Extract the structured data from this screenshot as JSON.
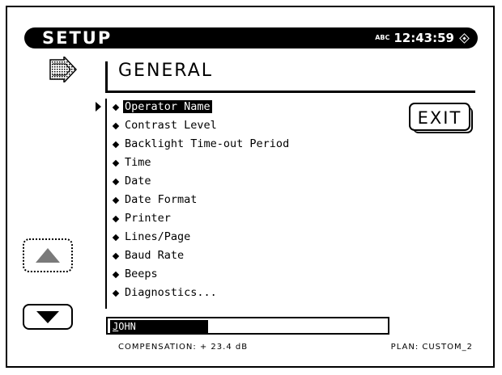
{
  "header": {
    "title": "SETUP",
    "status_small": "ABC",
    "time": "12:43:59",
    "status_icon": "diamond-icon"
  },
  "section": {
    "icon": "section-arrow-icon",
    "heading": "GENERAL"
  },
  "menu": {
    "items": [
      {
        "label": "Operator Name",
        "selected": true
      },
      {
        "label": "Contrast Level",
        "selected": false
      },
      {
        "label": "Backlight Time-out Period",
        "selected": false
      },
      {
        "label": "Time",
        "selected": false
      },
      {
        "label": "Date",
        "selected": false
      },
      {
        "label": "Date Format",
        "selected": false
      },
      {
        "label": "Printer",
        "selected": false
      },
      {
        "label": "Lines/Page",
        "selected": false
      },
      {
        "label": "Baud Rate",
        "selected": false
      },
      {
        "label": "Beeps",
        "selected": false
      },
      {
        "label": "Diagnostics...",
        "selected": false
      }
    ]
  },
  "buttons": {
    "exit_label": "EXIT",
    "scroll_up_icon": "triangle-up-icon",
    "scroll_down_icon": "triangle-down-icon"
  },
  "field": {
    "value_first": "J",
    "value_rest": "OHN"
  },
  "footer": {
    "compensation": "COMPENSATION: + 23.4 dB",
    "plan": "PLAN: CUSTOM_2"
  }
}
